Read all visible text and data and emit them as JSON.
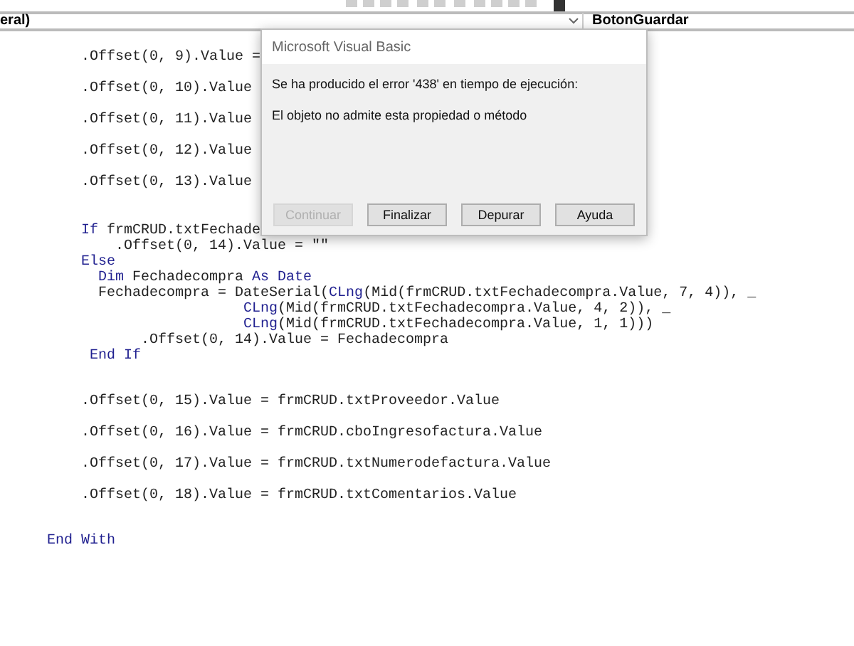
{
  "object_combo": {
    "value": "eral)"
  },
  "procedure_combo": {
    "value": "BotonGuardar"
  },
  "code_blocks": [
    {
      "lines": [
        {
          "segments": [
            {
              "kind": "text",
              "text": "    .Offset(0, 9).Value ="
            }
          ]
        }
      ]
    },
    {
      "lines": [
        {
          "segments": [
            {
              "kind": "text",
              "text": "    .Offset(0, 10).Value"
            }
          ]
        }
      ]
    },
    {
      "lines": [
        {
          "segments": [
            {
              "kind": "text",
              "text": "    .Offset(0, 11).Value"
            }
          ]
        }
      ]
    },
    {
      "lines": [
        {
          "segments": [
            {
              "kind": "text",
              "text": "    .Offset(0, 12).Value"
            }
          ]
        }
      ]
    },
    {
      "lines": [
        {
          "segments": [
            {
              "kind": "text",
              "text": "    .Offset(0, 13).Value"
            }
          ]
        }
      ]
    },
    {
      "lines": [
        {
          "segments": [
            {
              "kind": "keyword",
              "text": "    If"
            },
            {
              "kind": "text",
              "text": " frmCRUD.txtFechade"
            }
          ]
        },
        {
          "segments": [
            {
              "kind": "text",
              "text": "        .Offset(0, 14).Value = \"\""
            }
          ]
        },
        {
          "segments": [
            {
              "kind": "keyword",
              "text": "    Else"
            }
          ]
        },
        {
          "segments": [
            {
              "kind": "keyword",
              "text": "      Dim"
            },
            {
              "kind": "text",
              "text": " Fechadecompra "
            },
            {
              "kind": "keyword",
              "text": "As Date"
            }
          ]
        },
        {
          "segments": [
            {
              "kind": "text",
              "text": "      Fechadecompra = DateSerial("
            },
            {
              "kind": "keyword",
              "text": "CLng"
            },
            {
              "kind": "text",
              "text": "(Mid(frmCRUD.txtFechadecompra.Value, 7, 4)), _"
            }
          ]
        },
        {
          "segments": [
            {
              "kind": "keyword",
              "text": "                       CLng"
            },
            {
              "kind": "text",
              "text": "(Mid(frmCRUD.txtFechadecompra.Value, 4, 2)), _"
            }
          ]
        },
        {
          "segments": [
            {
              "kind": "keyword",
              "text": "                       CLng"
            },
            {
              "kind": "text",
              "text": "(Mid(frmCRUD.txtFechadecompra.Value, 1, 1)))"
            }
          ]
        },
        {
          "segments": [
            {
              "kind": "text",
              "text": "           .Offset(0, 14).Value = Fechadecompra"
            }
          ]
        },
        {
          "segments": [
            {
              "kind": "keyword",
              "text": "     End If"
            }
          ]
        }
      ]
    },
    {
      "lines": [
        {
          "segments": [
            {
              "kind": "text",
              "text": "    .Offset(0, 15).Value = frmCRUD.txtProveedor.Value"
            }
          ]
        }
      ]
    },
    {
      "lines": [
        {
          "segments": [
            {
              "kind": "text",
              "text": "    .Offset(0, 16).Value = frmCRUD.cboIngresofactura.Value"
            }
          ]
        }
      ]
    },
    {
      "lines": [
        {
          "segments": [
            {
              "kind": "text",
              "text": "    .Offset(0, 17).Value = frmCRUD.txtNumerodefactura.Value"
            }
          ]
        }
      ]
    },
    {
      "lines": [
        {
          "segments": [
            {
              "kind": "text",
              "text": "    .Offset(0, 18).Value = frmCRUD.txtComentarios.Value"
            }
          ]
        }
      ]
    },
    {
      "lines": [
        {
          "segments": [
            {
              "kind": "keyword",
              "text": "End With"
            }
          ]
        }
      ]
    }
  ],
  "dialog": {
    "title": "Microsoft Visual Basic",
    "message": "Se ha producido el error '438' en tiempo de ejecución:",
    "detail": "El objeto no admite esta propiedad o método",
    "buttons": [
      {
        "label": "Continuar",
        "disabled": true
      },
      {
        "label": "Finalizar",
        "disabled": false
      },
      {
        "label": "Depurar",
        "disabled": false
      },
      {
        "label": "Ayuda",
        "disabled": false
      }
    ]
  }
}
